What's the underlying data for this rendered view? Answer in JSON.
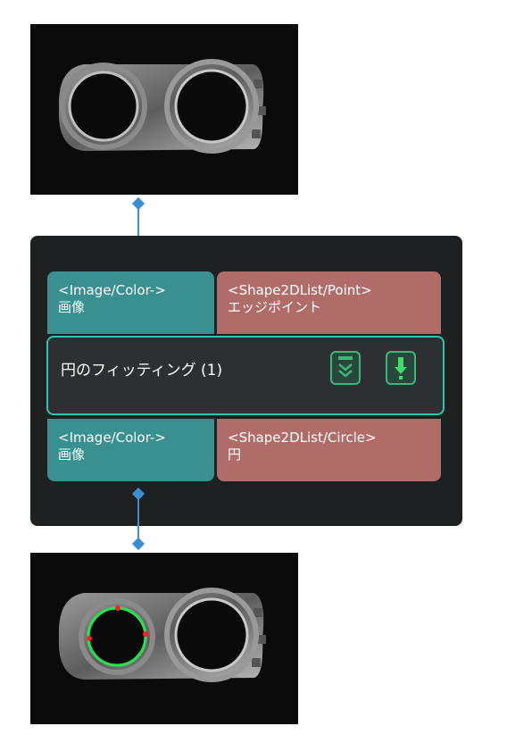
{
  "node": {
    "title": "円のフィッティング (1)",
    "inputs": [
      {
        "type_label": "<Image/Color->",
        "name": "画像"
      },
      {
        "type_label": "<Shape2DList/Point>",
        "name": "エッジポイント"
      }
    ],
    "outputs": [
      {
        "type_label": "<Image/Color->",
        "name": "画像"
      },
      {
        "type_label": "<Shape2DList/Circle>",
        "name": "円"
      }
    ],
    "buttons": [
      "chevrons-down-icon",
      "download-arrow-icon"
    ]
  },
  "colors": {
    "image_port": "#3a8f90",
    "shape_port": "#b06c69",
    "selection_border": "#32c3b0",
    "connector": "#3b8ed0",
    "fit_circle": "#22e34a",
    "edge_point": "#ff2020"
  }
}
